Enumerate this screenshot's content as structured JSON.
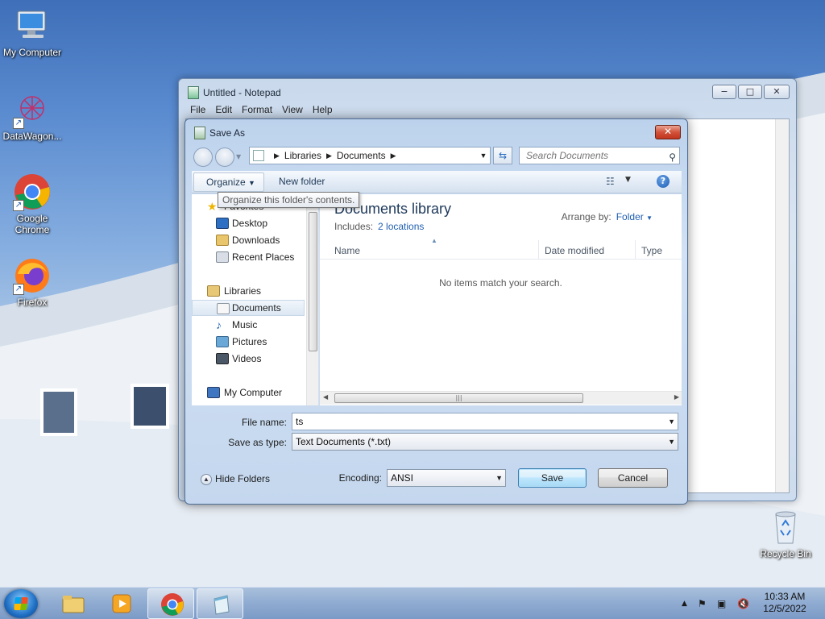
{
  "desktop": {
    "icons": [
      {
        "name": "My Computer"
      },
      {
        "name": "DataWagon..."
      },
      {
        "name": "Google Chrome",
        "line1": "Google",
        "line2": "Chrome"
      },
      {
        "name": "Firefox"
      },
      {
        "name": "Recycle Bin"
      }
    ]
  },
  "notepad": {
    "title": "Untitled - Notepad",
    "menu": [
      "File",
      "Edit",
      "Format",
      "View",
      "Help"
    ],
    "controls": {
      "minimize": "−",
      "maximize": "□",
      "close": "✕"
    }
  },
  "save_dialog": {
    "title": "Save As",
    "close": "✕",
    "breadcrumb": [
      "Libraries",
      "Documents"
    ],
    "search_placeholder": "Search Documents",
    "toolbar": {
      "organize": "Organize",
      "new_folder": "New folder"
    },
    "tooltip": "Organize this folder's contents.",
    "nav": {
      "favorites": "Favorites",
      "desktop": "Desktop",
      "downloads": "Downloads",
      "recent": "Recent Places",
      "libraries": "Libraries",
      "documents": "Documents",
      "music": "Music",
      "pictures": "Pictures",
      "videos": "Videos",
      "computer": "My Computer"
    },
    "library": {
      "title": "Documents library",
      "includes_label": "Includes:",
      "includes_link": "2 locations",
      "arrange_label": "Arrange by:",
      "arrange_value": "Folder"
    },
    "columns": [
      "Name",
      "Date modified",
      "Type"
    ],
    "empty_message": "No items match your search.",
    "file_name_label": "File name:",
    "file_name_value": "ts",
    "save_type_label": "Save as type:",
    "save_type_value": "Text Documents (*.txt)",
    "hide_folders": "Hide Folders",
    "encoding_label": "Encoding:",
    "encoding_value": "ANSI",
    "save_button": "Save",
    "cancel_button": "Cancel"
  },
  "taskbar": {
    "time": "10:33 AM",
    "date": "12/5/2022"
  },
  "colors": {
    "accent": "#1f5fb0",
    "close_red": "#c0341c",
    "library_title": "#1e395b"
  }
}
